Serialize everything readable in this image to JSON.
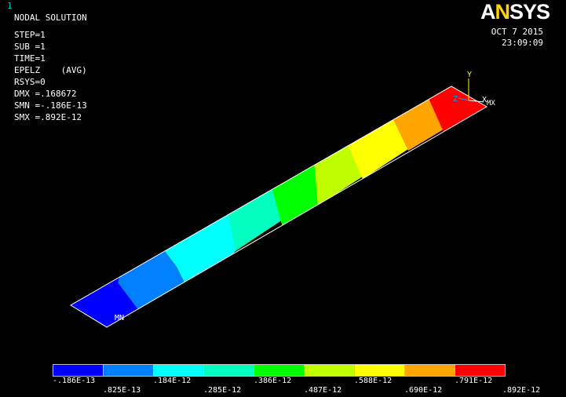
{
  "window_number": "1",
  "title": "NODAL SOLUTION",
  "info": [
    "STEP=1",
    "SUB =1",
    "TIME=1",
    "EPELZ    (AVG)",
    "RSYS=0",
    "DMX =.168672",
    "SMN =-.186E-13",
    "SMX =.892E-12"
  ],
  "logo": {
    "a": "A",
    "n": "N",
    "rest": "SYS"
  },
  "date": "OCT  7 2015",
  "time": "23:09:09",
  "triad": {
    "y": "Y",
    "z": "Z",
    "x": "X",
    "mx": "MX"
  },
  "min_marker": "MN",
  "colors": [
    "#0000ff",
    "#0080ff",
    "#00ffff",
    "#00ffc0",
    "#00ff00",
    "#c0ff00",
    "#ffff00",
    "#ffa500",
    "#ff0000"
  ],
  "legend_labels": [
    ".186E-13",
    ".825E-13",
    ".184E-12",
    ".285E-12",
    ".386E-12",
    ".487E-12",
    ".588E-12",
    ".690E-12",
    ".791E-12",
    ".892E-12"
  ]
}
